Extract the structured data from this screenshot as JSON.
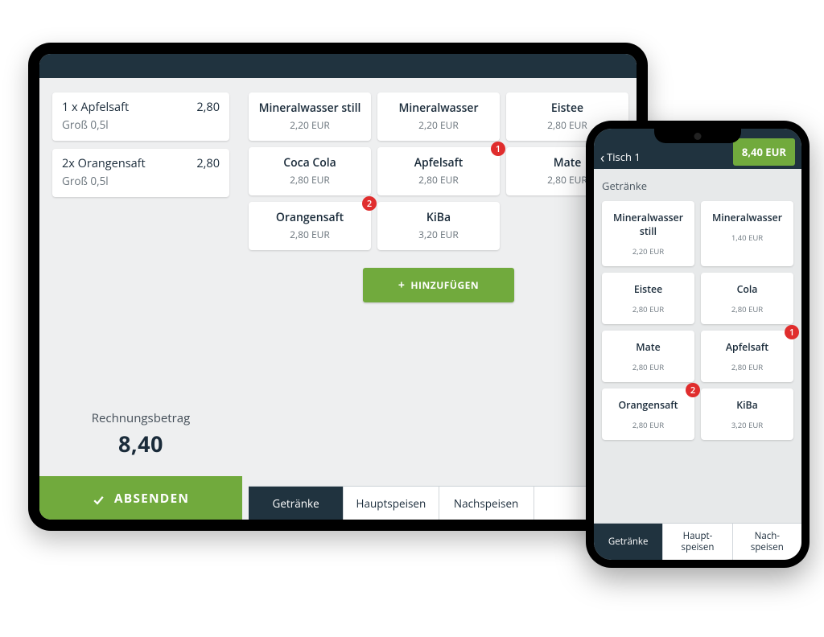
{
  "tablet": {
    "order_items": [
      {
        "title": "1 x Apfelsaft",
        "price": "2,80",
        "sub": "Groß 0,5l"
      },
      {
        "title": "2x Orangensaft",
        "price": "2,80",
        "sub": "Groß 0,5l"
      }
    ],
    "total_label": "Rechnungsbetrag",
    "total_value": "8,40",
    "send_label": "ABSENDEN",
    "products": [
      {
        "name": "Mineralwasser still",
        "price": "2,20 EUR",
        "badge": null
      },
      {
        "name": "Mineralwasser",
        "price": "2,20 EUR",
        "badge": null
      },
      {
        "name": "Eistee",
        "price": "2,80 EUR",
        "badge": null
      },
      {
        "name": "Coca Cola",
        "price": "2,80 EUR",
        "badge": null
      },
      {
        "name": "Apfelsaft",
        "price": "2,80 EUR",
        "badge": "1"
      },
      {
        "name": "Mate",
        "price": "2,80 EUR",
        "badge": null
      },
      {
        "name": "Orangensaft",
        "price": "2,80 EUR",
        "badge": "2"
      },
      {
        "name": "KiBa",
        "price": "3,20 EUR",
        "badge": null
      }
    ],
    "add_label": "HINZUFÜGEN",
    "tabs": [
      {
        "label": "Getränke",
        "active": true
      },
      {
        "label": "Hauptspeisen",
        "active": false
      },
      {
        "label": "Nachspeisen",
        "active": false
      },
      {
        "label": "",
        "active": false
      }
    ]
  },
  "phone": {
    "back_label": "Tisch 1",
    "total_btn": "8,40 EUR",
    "category_label": "Getränke",
    "products": [
      {
        "name": "Mineralwasser still",
        "price": "2,20 EUR",
        "badge": null
      },
      {
        "name": "Mineralwasser",
        "price": "1,40 EUR",
        "badge": null
      },
      {
        "name": "Eistee",
        "price": "2,80 EUR",
        "badge": null
      },
      {
        "name": "Cola",
        "price": "2,80 EUR",
        "badge": null
      },
      {
        "name": "Mate",
        "price": "2,80 EUR",
        "badge": null
      },
      {
        "name": "Apfelsaft",
        "price": "2,80 EUR",
        "badge": "1"
      },
      {
        "name": "Orangensaft",
        "price": "2,80 EUR",
        "badge": "2"
      },
      {
        "name": "KiBa",
        "price": "3,20 EUR",
        "badge": null
      }
    ],
    "tabs": [
      {
        "label": "Getränke",
        "active": true
      },
      {
        "label": "Haupt-\nspeisen",
        "active": false
      },
      {
        "label": "Nach-\nspeisen",
        "active": false
      }
    ]
  }
}
